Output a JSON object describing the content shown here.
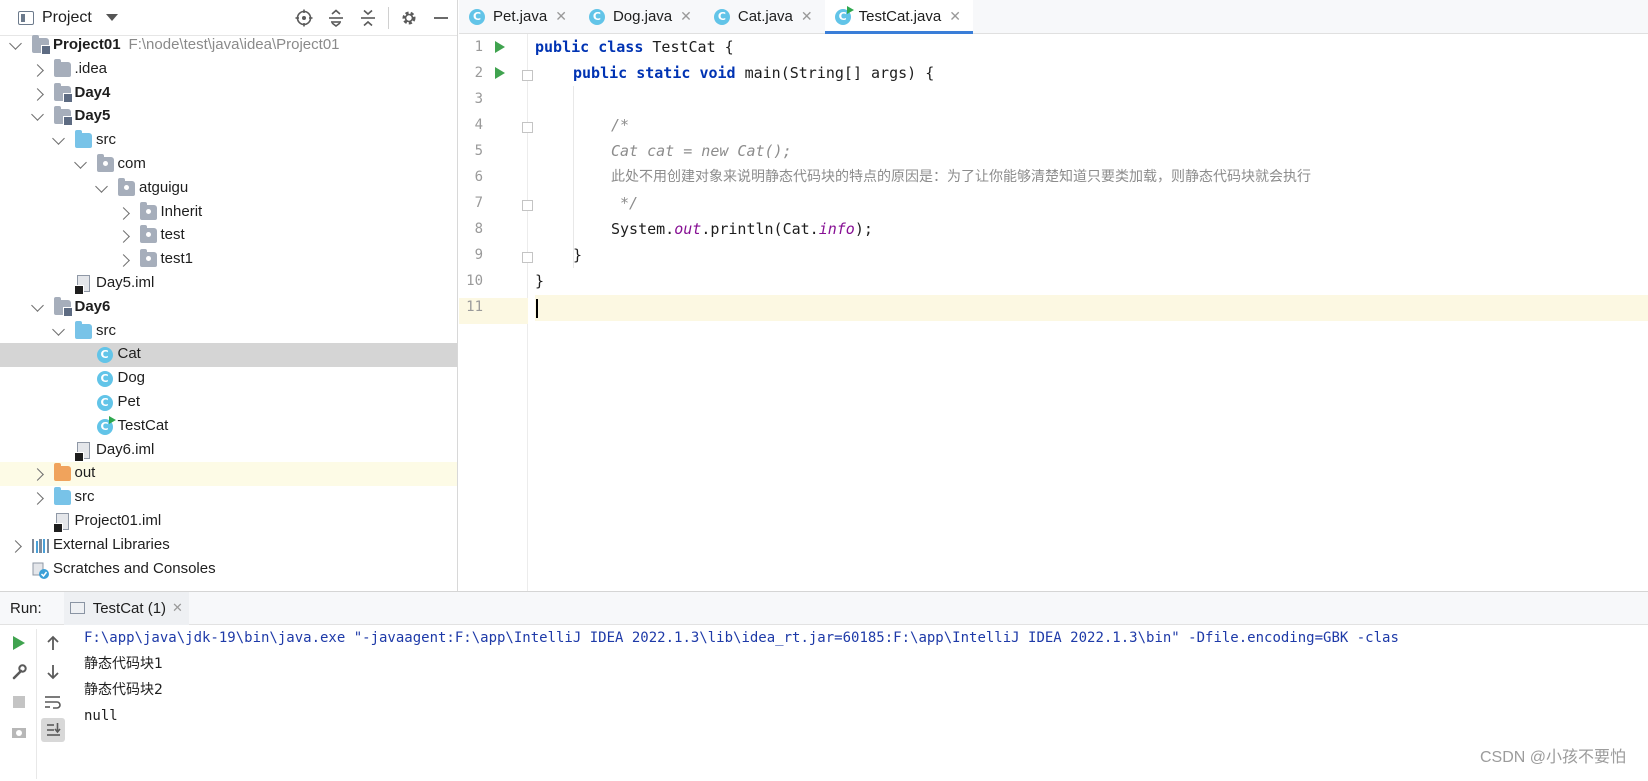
{
  "project_panel": {
    "title": "Project",
    "tools": [
      "locate-icon",
      "expand-all-icon",
      "collapse-all-icon",
      "gear-icon",
      "minimize-icon"
    ],
    "tree": [
      {
        "label": "Project01",
        "path": "F:\\node\\test\\java\\idea\\Project01",
        "bold": true,
        "state": "open",
        "icon": "module-folder"
      },
      {
        "label": ".idea",
        "state": "closed",
        "icon": "folder"
      },
      {
        "label": "Day4",
        "bold": true,
        "state": "closed",
        "icon": "module-folder"
      },
      {
        "label": "Day5",
        "bold": true,
        "state": "open",
        "icon": "module-folder"
      },
      {
        "label": "src",
        "state": "open",
        "icon": "source-folder"
      },
      {
        "label": "com",
        "state": "open",
        "icon": "package"
      },
      {
        "label": "atguigu",
        "state": "open",
        "icon": "package"
      },
      {
        "label": "Inherit",
        "state": "closed",
        "icon": "package"
      },
      {
        "label": "test",
        "state": "closed",
        "icon": "package"
      },
      {
        "label": "test1",
        "state": "closed",
        "icon": "package"
      },
      {
        "label": "Day5.iml",
        "icon": "iml-file"
      },
      {
        "label": "Day6",
        "bold": true,
        "state": "open",
        "icon": "module-folder"
      },
      {
        "label": "src",
        "state": "open",
        "icon": "source-folder"
      },
      {
        "label": "Cat",
        "icon": "class",
        "selected": true
      },
      {
        "label": "Dog",
        "icon": "class"
      },
      {
        "label": "Pet",
        "icon": "class"
      },
      {
        "label": "TestCat",
        "icon": "runnable-class"
      },
      {
        "label": "Day6.iml",
        "icon": "iml-file"
      },
      {
        "label": "out",
        "state": "closed",
        "icon": "excluded-folder"
      },
      {
        "label": "src",
        "state": "closed",
        "icon": "source-folder"
      },
      {
        "label": "Project01.iml",
        "icon": "iml-file"
      },
      {
        "label": "External Libraries",
        "state": "closed",
        "icon": "libraries"
      },
      {
        "label": "Scratches and Consoles",
        "icon": "scratches"
      }
    ]
  },
  "editor": {
    "tabs": [
      {
        "label": "Pet.java",
        "icon_letter": "C",
        "active": false
      },
      {
        "label": "Dog.java",
        "icon_letter": "C",
        "active": false
      },
      {
        "label": "Cat.java",
        "icon_letter": "C",
        "active": false
      },
      {
        "label": "TestCat.java",
        "icon_letter": "C",
        "active": true
      }
    ],
    "line_numbers": [
      "1",
      "2",
      "3",
      "4",
      "5",
      "6",
      "7",
      "8",
      "9",
      "10",
      "11"
    ],
    "code": {
      "l1_kw1": "public",
      "l1_kw2": "class",
      "l1_rest": " TestCat {",
      "l2_kw1": "public",
      "l2_kw2": "static",
      "l2_kw3": "void",
      "l2_rest": " main(String[] args) {",
      "l4": "/*",
      "l5": "Cat cat = new Cat();",
      "l6": "此处不用创建对象来说明静态代码块的特点的原因是：为了让你能够清楚知道只要类加载，则静态代码块就会执行",
      "l7": " */",
      "l8_a": "System.",
      "l8_b": "out",
      "l8_c": ".println(Cat.",
      "l8_d": "info",
      "l8_e": ");",
      "l9": "}",
      "l10": "}"
    },
    "current_line": "11"
  },
  "run_panel": {
    "label": "Run:",
    "tab_label": "TestCat (1)",
    "tools": [
      "rerun-icon",
      "up-arrow-icon",
      "wrench-icon",
      "down-arrow-icon",
      "stop-icon",
      "soft-wrap-icon",
      "camera-icon",
      "scroll-to-end-icon"
    ],
    "console": [
      "F:\\app\\java\\jdk-19\\bin\\java.exe \"-javaagent:F:\\app\\IntelliJ IDEA 2022.1.3\\lib\\idea_rt.jar=60185:F:\\app\\IntelliJ IDEA 2022.1.3\\bin\" -Dfile.encoding=GBK -clas",
      "静态代码块1",
      "静态代码块2",
      "null"
    ]
  },
  "watermark": "CSDN @小孩不要怕",
  "colors": {
    "keyword": "#0033b3",
    "comment": "#8c8c8c",
    "static_field": "#871094",
    "caret_line": "#fcf8e2",
    "tab_underline": "#3a7ed8",
    "run_green": "#40a34f"
  }
}
